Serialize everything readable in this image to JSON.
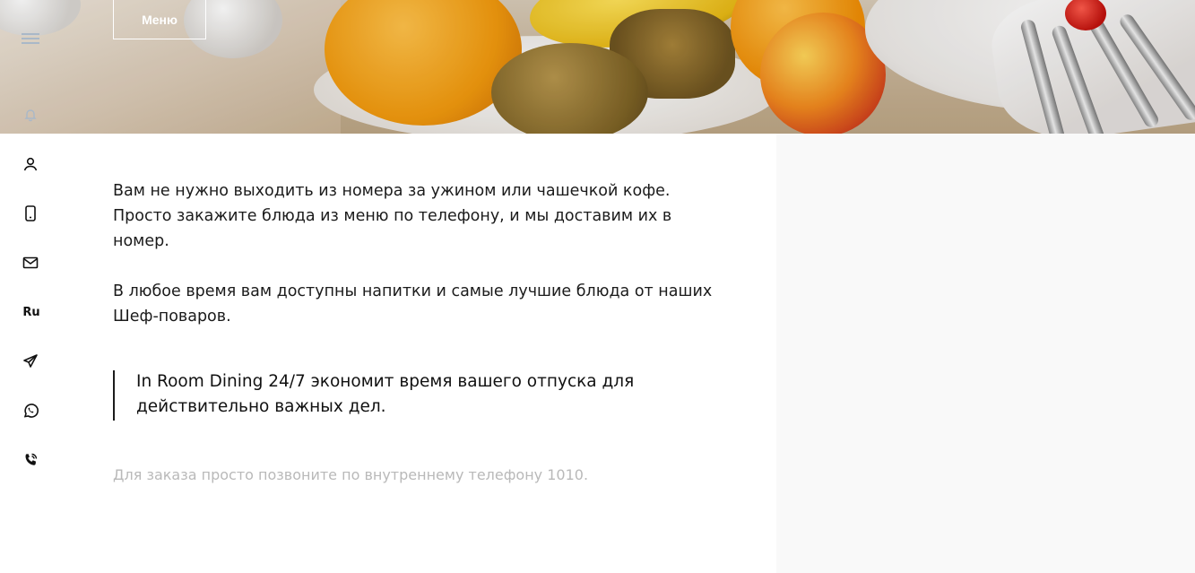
{
  "hero": {
    "menu_button_label": "Меню"
  },
  "sidebar": {
    "language": "Ru",
    "icons": [
      "hamburger-menu-icon",
      "bell-icon",
      "user-icon",
      "phone-icon",
      "mail-icon",
      "telegram-icon",
      "whatsapp-icon",
      "phone-call-icon"
    ]
  },
  "content": {
    "paragraph_1": "Вам не нужно выходить из номера за ужином или чашечкой кофе. Просто закажите блюда из меню по телефону, и мы доставим их в номер.",
    "paragraph_2": "В любое время вам доступны напитки и самые лучшие блюда от наших Шеф-поваров.",
    "quote": "In Room Dining 24/7 экономит время вашего отпуска для действительно важных дел.",
    "note": "Для заказа просто позвоните по внутреннему телефону 1010."
  },
  "colors": {
    "text": "#1b1b1b",
    "muted": "#b9b9b9",
    "panel": "#f9f9f9",
    "sidebar_faded": "#a9b8c8"
  }
}
